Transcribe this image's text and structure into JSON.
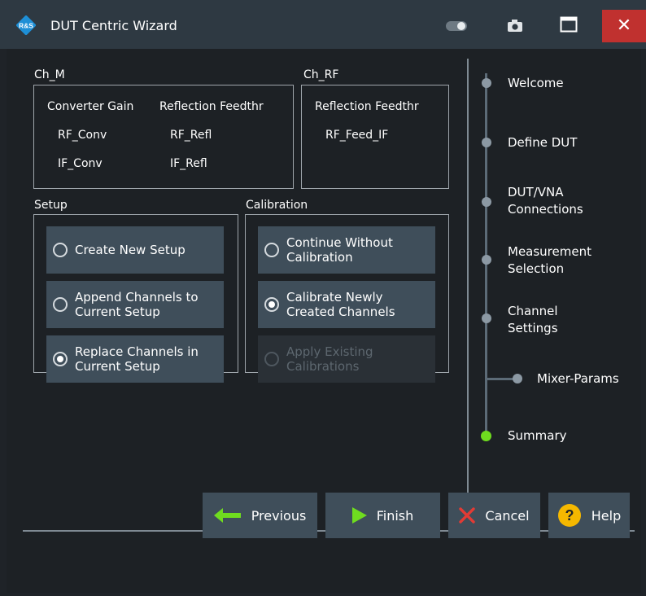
{
  "window": {
    "title": "DUT Centric Wizard",
    "close_label": "✕"
  },
  "channels": {
    "ch_m": {
      "label": "Ch_M",
      "col1_header": "Converter Gain",
      "col2_header": "Reflection Feedthr",
      "rows": [
        [
          "RF_Conv",
          "RF_Refl"
        ],
        [
          "IF_Conv",
          "IF_Refl"
        ]
      ]
    },
    "ch_rf": {
      "label": "Ch_RF",
      "col1_header": "Reflection Feedthr",
      "rows": [
        [
          "RF_Feed_IF"
        ]
      ]
    }
  },
  "setup": {
    "label": "Setup",
    "options": [
      {
        "label": "Create New Setup",
        "checked": false,
        "enabled": true
      },
      {
        "label": "Append Channels to\nCurrent Setup",
        "checked": false,
        "enabled": true
      },
      {
        "label": "Replace Channels in\nCurrent Setup",
        "checked": true,
        "enabled": true
      }
    ]
  },
  "calibration": {
    "label": "Calibration",
    "options": [
      {
        "label": "Continue Without\nCalibration",
        "checked": false,
        "enabled": true
      },
      {
        "label": "Calibrate Newly\nCreated Channels",
        "checked": true,
        "enabled": true
      },
      {
        "label": "Apply Existing\nCalibrations",
        "checked": false,
        "enabled": false
      }
    ]
  },
  "steps": [
    {
      "label": "Welcome",
      "active": false
    },
    {
      "label": "Define DUT",
      "active": false
    },
    {
      "label": "DUT/VNA\nConnections",
      "active": false
    },
    {
      "label": "Measurement\nSelection",
      "active": false
    },
    {
      "label": "Channel\nSettings",
      "active": false
    },
    {
      "label": "Mixer-Params",
      "active": false
    },
    {
      "label": "Summary",
      "active": true
    }
  ],
  "footer": {
    "previous_label": "Previous",
    "finish_label": "Finish",
    "cancel_label": "Cancel",
    "help_label": "Help"
  },
  "colors": {
    "accent_green": "#6fdc1f",
    "close_red": "#c0312f",
    "button_bg": "#3f4e5a",
    "help_yellow": "#f5b800"
  }
}
